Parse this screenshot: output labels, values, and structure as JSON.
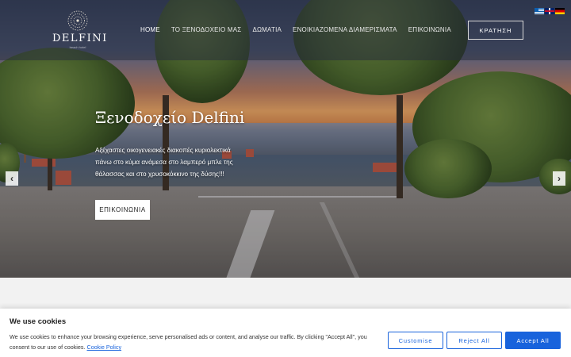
{
  "brand": {
    "name": "DELFINI",
    "tagline": "beach hotel"
  },
  "nav": {
    "items": [
      {
        "label": "HOME"
      },
      {
        "label": "ΤΟ ΞΕΝΟΔΟΧΕΙΟ ΜΑΣ"
      },
      {
        "label": "ΔΩΜΑΤΙΑ"
      },
      {
        "label": "ΕΝΟΙΚΙΑΖΟΜΕΝΑ ΔΙΑΜΕΡΙΣΜΑΤΑ"
      },
      {
        "label": "ΕΠΙΚΟΙΝΩΝΙΑ"
      }
    ],
    "book_label": "ΚΡΑΤΗΣΗ"
  },
  "languages": [
    "greek-flag-icon",
    "uk-flag-icon",
    "german-flag-icon"
  ],
  "hero": {
    "title": "Ξενοδοχείο Delfini",
    "description": "Αξέχαστες οικογενειακές διακοπές κυριολεκτικά πάνω στο κύμα ανάμεσα στο λαμπερό μπλε της θάλασσας και στο χρυσοκόκκινο της δύσης!!!",
    "button_label": "ΕΠΙΚΟΙΝΩΝΙΑ",
    "prev_icon": "chevron-left-icon",
    "next_icon": "chevron-right-icon"
  },
  "cookie": {
    "title": "We use cookies",
    "text": "We use cookies to enhance your browsing experience, serve personalised ads or content, and analyse our traffic. By clicking \"Accept All\", you consent to our use of cookies.",
    "link_label": "Cookie Policy",
    "customise_label": "Customise",
    "reject_label": "Reject All",
    "accept_label": "Accept All"
  },
  "colors": {
    "accent": "#1863dc",
    "header_overlay": "#282e3c"
  }
}
